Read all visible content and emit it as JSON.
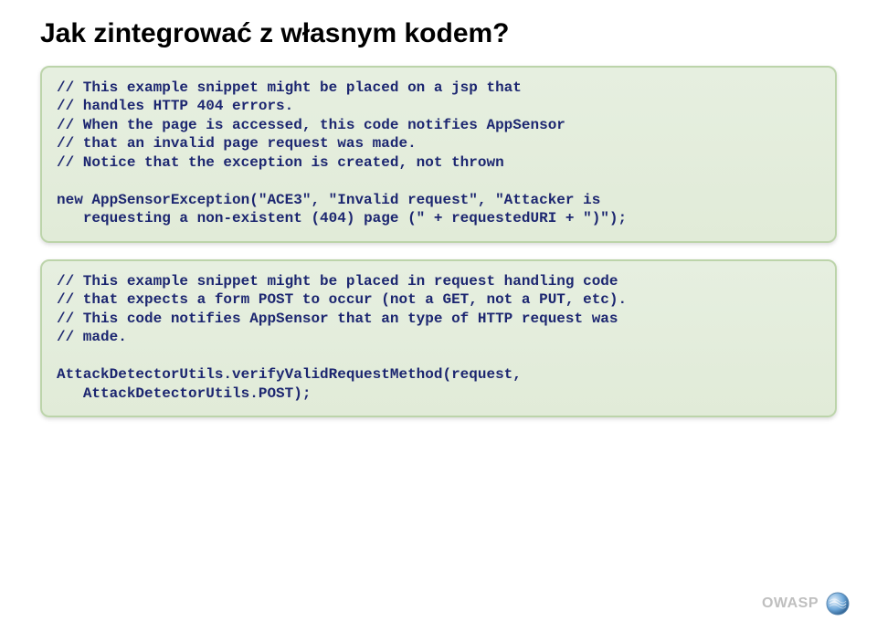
{
  "title": "Jak zintegrować z własnym kodem?",
  "code1": "// This example snippet might be placed on a jsp that\n// handles HTTP 404 errors.\n// When the page is accessed, this code notifies AppSensor\n// that an invalid page request was made.\n// Notice that the exception is created, not thrown\n\nnew AppSensorException(\"ACE3\", \"Invalid request\", \"Attacker is\n   requesting a non-existent (404) page (\" + requestedURI + \")\");",
  "code2": "// This example snippet might be placed in request handling code\n// that expects a form POST to occur (not a GET, not a PUT, etc).\n// This code notifies AppSensor that an type of HTTP request was\n// made.\n\nAttackDetectorUtils.verifyValidRequestMethod(request,\n   AttackDetectorUtils.POST);",
  "footer": "OWASP"
}
